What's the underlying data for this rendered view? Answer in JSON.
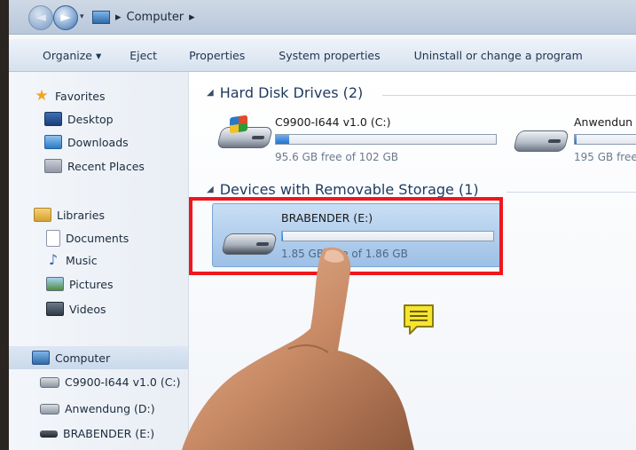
{
  "address_bar": {
    "location": "Computer",
    "back_glyph": "◄",
    "forward_glyph": "►",
    "dropdown_glyph": "▾",
    "separator_glyph": "▸"
  },
  "toolbar": {
    "organize": "Organize ▾",
    "eject": "Eject",
    "properties": "Properties",
    "system_properties": "System properties",
    "uninstall": "Uninstall or change a program"
  },
  "sidebar": {
    "favorites": {
      "label": "Favorites",
      "icon": "star-icon"
    },
    "favorites_items": [
      {
        "label": "Desktop",
        "icon": "desktop-icon"
      },
      {
        "label": "Downloads",
        "icon": "downloads-icon"
      },
      {
        "label": "Recent Places",
        "icon": "recent-places-icon"
      }
    ],
    "libraries": {
      "label": "Libraries",
      "icon": "libraries-icon"
    },
    "libraries_items": [
      {
        "label": "Documents",
        "icon": "documents-icon"
      },
      {
        "label": "Music",
        "icon": "music-icon"
      },
      {
        "label": "Pictures",
        "icon": "pictures-icon"
      },
      {
        "label": "Videos",
        "icon": "videos-icon"
      }
    ],
    "computer": {
      "label": "Computer",
      "icon": "computer-icon"
    },
    "computer_items": [
      {
        "label": "C9900-I644 v1.0 (C:)",
        "icon": "drive-c-icon"
      },
      {
        "label": "Anwendung (D:)",
        "icon": "drive-d-icon"
      },
      {
        "label": "BRABENDER (E:)",
        "icon": "usb-drive-icon"
      }
    ]
  },
  "groups": {
    "hard_disks": {
      "title": "Hard Disk Drives (2)",
      "drives": [
        {
          "name": "C9900-I644 v1.0 (C:)",
          "free_text": "95.6 GB free of 102 GB",
          "used_fraction": 0.06
        },
        {
          "name": "Anwendun",
          "free_text": "195 GB free",
          "used_fraction": 0.02
        }
      ]
    },
    "removable": {
      "title": "Devices with Removable Storage (1)",
      "drives": [
        {
          "name": "BRABENDER (E:)",
          "free_text": "1.85 GB free of 1.86 GB",
          "used_fraction": 0.005
        }
      ]
    }
  },
  "colors": {
    "highlight": "#f0161d",
    "selection": "#c9def4",
    "progress": "#2573c9",
    "note": "#f5e52f"
  }
}
